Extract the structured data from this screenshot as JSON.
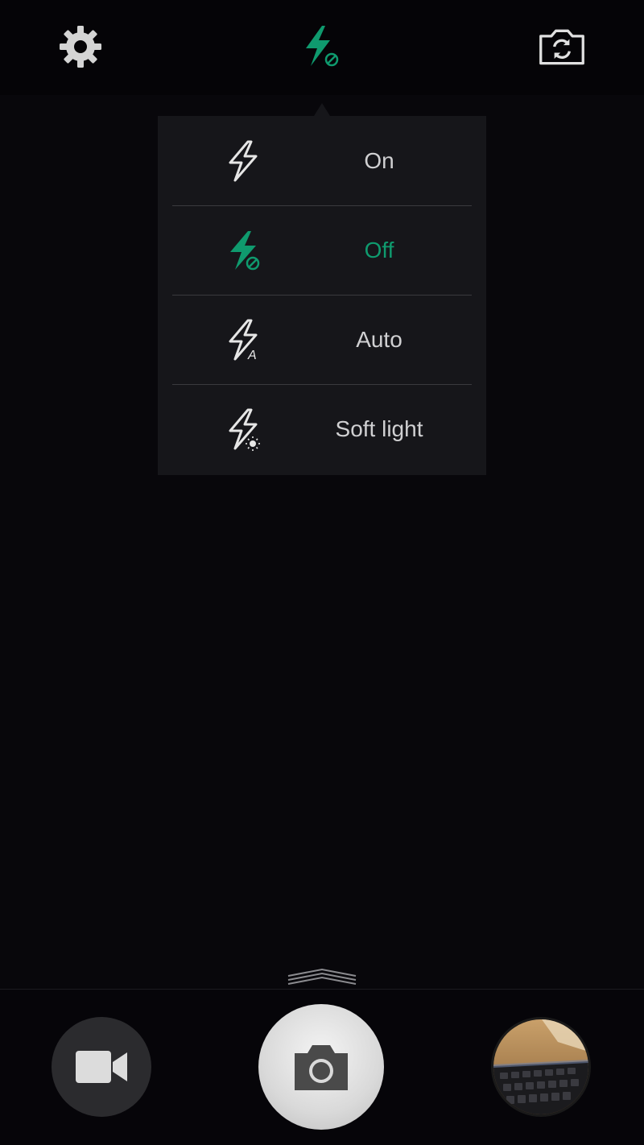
{
  "topbar": {
    "icons": [
      "gear-icon",
      "flash-off-icon",
      "camera-switch-icon"
    ],
    "active_color": "#0f9a6e"
  },
  "flash_menu": {
    "items": [
      {
        "label": "On",
        "icon": "flash-on-icon",
        "selected": false
      },
      {
        "label": "Off",
        "icon": "flash-off-icon",
        "selected": true
      },
      {
        "label": "Auto",
        "icon": "flash-auto-icon",
        "selected": false
      },
      {
        "label": "Soft light",
        "icon": "flash-soft-light-icon",
        "selected": false
      }
    ]
  },
  "bottombar": {
    "icons": [
      "video-camera-icon",
      "camera-icon",
      "gallery-thumbnail"
    ]
  },
  "colors": {
    "accent": "#0f9a6e",
    "menu_background": "#16161a",
    "text": "#d0d0d2"
  }
}
